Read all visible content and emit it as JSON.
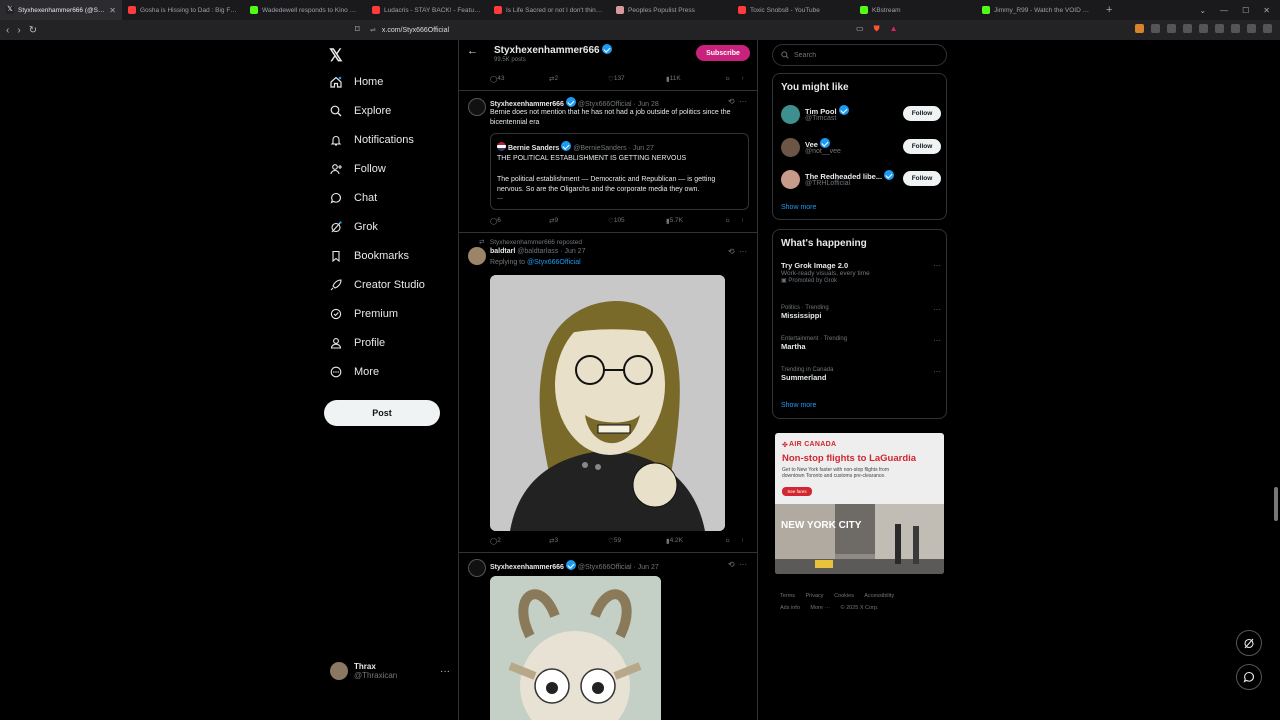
{
  "browser": {
    "tabs": [
      {
        "title": "Styxhexenhammer666 (@Styx666...",
        "icon_color": "#e7e9ea",
        "active": true
      },
      {
        "title": "Gosha is Hissing to Dad : Big Floppa",
        "icon_color": "#ff3b3b"
      },
      {
        "title": "Wadedewell responds to Kino Casino",
        "icon_color": "#53fc18"
      },
      {
        "title": "Ludacris - STAY BACK! - Featuring Ar...",
        "icon_color": "#ff3b3b"
      },
      {
        "title": "Is Life Sacred or not I don't think it...",
        "icon_color": "#ff3b3b"
      },
      {
        "title": "Peoples Populist Press",
        "icon_color": "#d69a9a"
      },
      {
        "title": "Toxic Snobs8 - YouTube",
        "icon_color": "#ff3b3b"
      },
      {
        "title": "KBstream",
        "icon_color": "#53fc18"
      },
      {
        "title": "Jimmy_R99 - Watch the VOID on Kick",
        "icon_color": "#53fc18"
      }
    ],
    "url": "x.com/Styx666Official"
  },
  "nav": {
    "items": [
      {
        "label": "Home",
        "icon": "home-icon"
      },
      {
        "label": "Explore",
        "icon": "search-icon"
      },
      {
        "label": "Notifications",
        "icon": "bell-icon"
      },
      {
        "label": "Follow",
        "icon": "person-add-icon"
      },
      {
        "label": "Chat",
        "icon": "chat-icon"
      },
      {
        "label": "Grok",
        "icon": "grok-icon"
      },
      {
        "label": "Bookmarks",
        "icon": "bookmark-icon"
      },
      {
        "label": "Creator Studio",
        "icon": "rocket-icon"
      },
      {
        "label": "Premium",
        "icon": "premium-icon"
      },
      {
        "label": "Profile",
        "icon": "person-icon"
      },
      {
        "label": "More",
        "icon": "more-circle-icon"
      }
    ],
    "post_label": "Post",
    "account": {
      "name": "Thrax",
      "handle": "@Thraxican"
    }
  },
  "profile_header": {
    "name": "Styxhexenhammer666",
    "post_count": "99.5K posts",
    "subscribe_label": "Subscribe"
  },
  "feed": {
    "top_actions": {
      "replies": "43",
      "reposts": "2",
      "likes": "137",
      "views": "11K"
    },
    "tweet1": {
      "name": "Styxhexenhammer666",
      "handle": "@Styx666Official",
      "date": "· Jun 28",
      "text": "Bernie does not mention that he has not had a job outside of politics since the bicentennial era",
      "quote": {
        "name": "Bernie Sanders",
        "handle": "@BernieSanders",
        "date": "· Jun 27",
        "line1": "THE POLITICAL ESTABLISHMENT IS GETTING NERVOUS",
        "line2": "The political establishment — Democratic and Republican — is getting nervous. So are the Oligarchs and the corporate media they own.",
        "line3": "..."
      },
      "actions": {
        "replies": "6",
        "reposts": "9",
        "likes": "105",
        "views": "5.7K"
      }
    },
    "tweet2": {
      "repost_label": "Styxhexenhammer666 reposted",
      "name": "baldtarl",
      "handle": "@baldtarlass",
      "date": "· Jun 27",
      "replying_to_label": "Replying to",
      "replying_to": "@Styx666Official",
      "actions": {
        "replies": "2",
        "reposts": "3",
        "likes": "59",
        "views": "4.2K"
      }
    },
    "tweet3": {
      "name": "Styxhexenhammer666",
      "handle": "@Styx666Official",
      "date": "· Jun 27"
    }
  },
  "sidebar": {
    "search_placeholder": "Search",
    "you_might_like": {
      "title": "You might like",
      "users": [
        {
          "name": "Tim Pool",
          "handle": "@Timcast",
          "follow": "Follow",
          "avatar_color": "#3f8f8f"
        },
        {
          "name": "Vee",
          "handle": "@not__vee",
          "follow": "Follow",
          "avatar_color": "#6b5546"
        },
        {
          "name": "The Redheaded libe...",
          "handle": "@TRHLofficial",
          "follow": "Follow",
          "avatar_color": "#c79a8a"
        }
      ],
      "show_more": "Show more"
    },
    "whats_happening": {
      "title": "What's happening",
      "trends": [
        {
          "category": "",
          "title": "Try Grok Image 2.0",
          "sub": "Work-ready visuals, every time",
          "promo": "Promoted by Grok"
        },
        {
          "category": "Politics · Trending",
          "title": "Mississippi",
          "sub": "",
          "promo": ""
        },
        {
          "category": "Entertainment · Trending",
          "title": "Martha",
          "sub": "",
          "promo": ""
        },
        {
          "category": "Trending in Canada",
          "title": "Summerland",
          "sub": "",
          "promo": ""
        }
      ],
      "show_more": "Show more"
    },
    "ad": {
      "brand": "AIR CANADA",
      "headline": "Non-stop flights to LaGuardia",
      "copy": "Get to New York faster with non-stop flights from downtown Toronto and customs pre-clearance.",
      "cta": "See fares",
      "scene_text": "NEW YORK CITY"
    },
    "footer": [
      "Terms",
      "Privacy",
      "Cookies",
      "Accessibility",
      "Ads info",
      "More ···",
      "© 2025 X Corp."
    ]
  }
}
